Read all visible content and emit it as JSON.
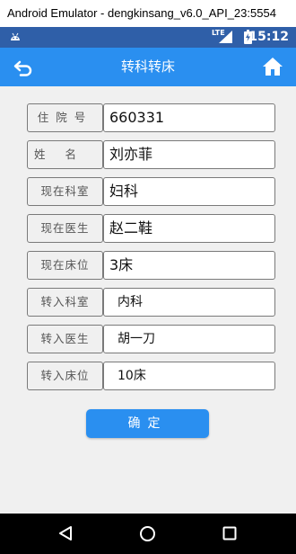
{
  "window": {
    "title": "Android Emulator - dengkinsang_v6.0_API_23:5554"
  },
  "status_bar": {
    "network": "LTE",
    "time": "15:12"
  },
  "app_bar": {
    "title": "转科转床",
    "back_icon": "back-arrow-icon",
    "home_icon": "home-icon"
  },
  "form": {
    "fields": [
      {
        "label": "住院号",
        "value": "660331"
      },
      {
        "label": "姓名",
        "value": "刘亦菲"
      },
      {
        "label": "现在科室",
        "value": "妇科"
      },
      {
        "label": "现在医生",
        "value": "赵二鞋"
      },
      {
        "label": "现在床位",
        "value": "3床"
      },
      {
        "label": "转入科室",
        "value": "内科"
      },
      {
        "label": "转入医生",
        "value": "胡一刀"
      },
      {
        "label": "转入床位",
        "value": "10床"
      }
    ],
    "confirm_label": "确定"
  },
  "colors": {
    "status_bar": "#2f5fa8",
    "app_bar": "#2a8ff0",
    "button": "#2a8ff0",
    "content_bg": "#f0f0f0"
  }
}
